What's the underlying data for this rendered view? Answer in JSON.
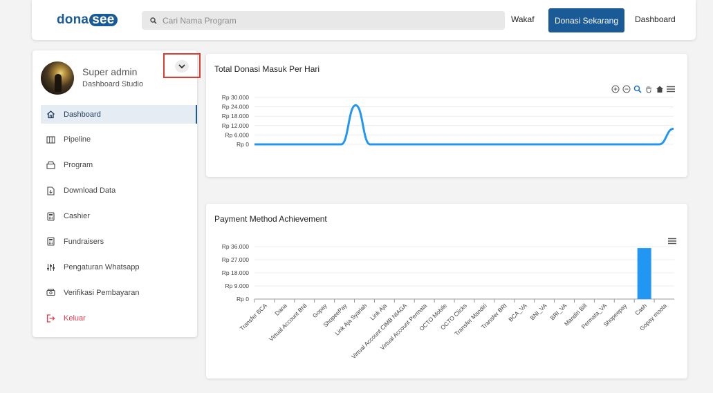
{
  "header": {
    "logo_prefix": "dona",
    "logo_suffix": "see",
    "search_placeholder": "Cari Nama Program",
    "nav_wakaf": "Wakaf",
    "donate_button": "Donasi Sekarang",
    "nav_dashboard": "Dashboard",
    "brand_color": "#1a5a96"
  },
  "profile": {
    "name": "Super admin",
    "role": "Dashboard Studio"
  },
  "sidebar": {
    "items": [
      {
        "label": "Dashboard",
        "icon": "home-icon",
        "active": true
      },
      {
        "label": "Pipeline",
        "icon": "columns-icon"
      },
      {
        "label": "Program",
        "icon": "box-icon"
      },
      {
        "label": "Download Data",
        "icon": "download-file-icon"
      },
      {
        "label": "Cashier",
        "icon": "calculator-icon"
      },
      {
        "label": "Fundraisers",
        "icon": "calculator-icon"
      },
      {
        "label": "Pengaturan Whatsapp",
        "icon": "sliders-icon"
      },
      {
        "label": "Verifikasi Pembayaran",
        "icon": "cash-icon"
      },
      {
        "label": "Keluar",
        "icon": "logout-icon",
        "danger": true
      }
    ]
  },
  "charts": {
    "daily": {
      "title": "Total Donasi Masuk Per Hari"
    },
    "payment": {
      "title": "Payment Method Achievement"
    }
  },
  "chart_data": [
    {
      "type": "line",
      "title": "Total Donasi Masuk Per Hari",
      "y_ticks": [
        "Rp 30.000",
        "Rp 24.000",
        "Rp 18.000",
        "Rp 12.000",
        "Rp 6.000",
        "Rp 0"
      ],
      "ylim": [
        0,
        30000
      ],
      "x": [
        0,
        1,
        2,
        3,
        4,
        5,
        6,
        7,
        8,
        9,
        10,
        11,
        12,
        13,
        14,
        15,
        16,
        17,
        18,
        19,
        20,
        21,
        22,
        23,
        24,
        25,
        26,
        27,
        28,
        29
      ],
      "values": [
        0,
        0,
        0,
        0,
        0,
        0,
        0,
        25000,
        0,
        0,
        0,
        0,
        0,
        0,
        0,
        0,
        0,
        0,
        0,
        0,
        0,
        0,
        0,
        0,
        0,
        0,
        0,
        0,
        0,
        10000
      ],
      "color": "#2196f3",
      "grid": true
    },
    {
      "type": "bar",
      "title": "Payment Method Achievement",
      "y_ticks": [
        "Rp 36.000",
        "Rp 27.000",
        "Rp 18.000",
        "Rp 9.000",
        "Rp 0"
      ],
      "ylim": [
        0,
        36000
      ],
      "categories": [
        "Transfer BCA",
        "Dana",
        "Virtual Account BNI",
        "Gopay",
        "ShopeePay",
        "Link Aja Syariah",
        "Link Aja",
        "Virtual Account CIMB NIAGA",
        "Virtual Account Permata",
        "OCTO Mobile",
        "OCTO Clicks",
        "Transfer Mandiri",
        "Transfer BRI",
        "BCA_VA",
        "BNI_VA",
        "BRI_VA",
        "Mandiri Bill",
        "Permata_VA",
        "Shopeepay",
        "Cash",
        "Gopay moota"
      ],
      "values": [
        0,
        0,
        0,
        0,
        0,
        0,
        0,
        0,
        0,
        0,
        0,
        0,
        0,
        0,
        0,
        0,
        0,
        0,
        0,
        35000,
        0
      ],
      "color": "#2196f3",
      "grid": true
    }
  ]
}
